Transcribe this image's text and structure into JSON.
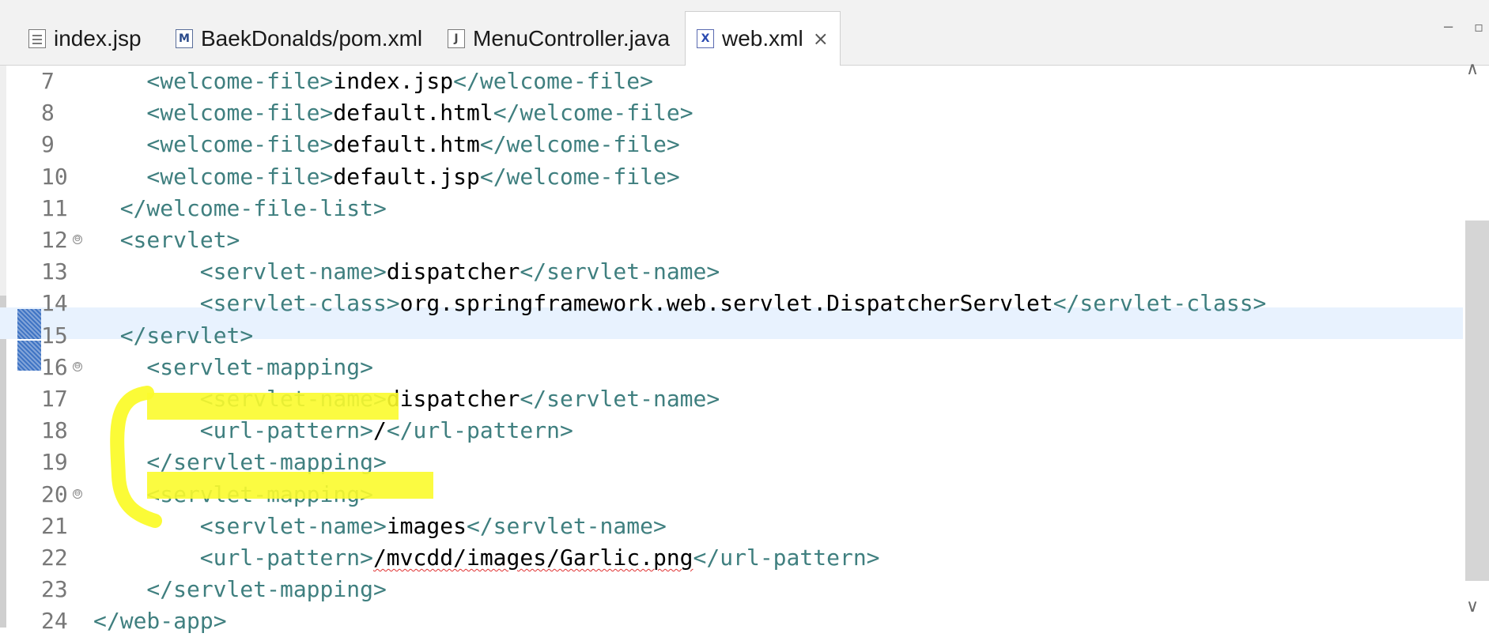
{
  "tabs": [
    {
      "label": "index.jsp",
      "icon": "jsp-file-icon",
      "active": false
    },
    {
      "label": "BaekDonalds/pom.xml",
      "icon": "maven-pom-icon",
      "active": false
    },
    {
      "label": "MenuController.java",
      "icon": "java-file-icon",
      "active": false
    },
    {
      "label": "web.xml",
      "icon": "xml-file-icon",
      "active": true
    }
  ],
  "tab_close_glyph": "×",
  "window_controls": {
    "minimize": "−",
    "maximize": "▫"
  },
  "scrollbar": {
    "up": "∧",
    "down": "∨"
  },
  "fold_glyph": "⊖",
  "highlight_color": "#fbfb2c",
  "current_line": "15",
  "editor": {
    "lines": [
      {
        "n": "7",
        "pre": "    ",
        "open": "<welcome-file>",
        "text": "index.jsp",
        "close": "</welcome-file>"
      },
      {
        "n": "8",
        "pre": "    ",
        "open": "<welcome-file>",
        "text": "default.html",
        "close": "</welcome-file>"
      },
      {
        "n": "9",
        "pre": "    ",
        "open": "<welcome-file>",
        "text": "default.htm",
        "close": "</welcome-file>"
      },
      {
        "n": "10",
        "pre": "    ",
        "open": "<welcome-file>",
        "text": "default.jsp",
        "close": "</welcome-file>"
      },
      {
        "n": "11",
        "pre": "  ",
        "open": "</welcome-file-list>"
      },
      {
        "n": "12",
        "pre": "  ",
        "open": "<servlet>"
      },
      {
        "n": "13",
        "pre": "        ",
        "open": "<servlet-name>",
        "text": "dispatcher",
        "close": "</servlet-name>"
      },
      {
        "n": "14",
        "pre": "        ",
        "open": "<servlet-class>",
        "text": "org.springframework.web.servlet.DispatcherServlet",
        "close": "</servlet-class>"
      },
      {
        "n": "15",
        "pre": "  ",
        "open": "</servlet>"
      },
      {
        "n": "16",
        "pre": "    ",
        "open": "<servlet-mapping>"
      },
      {
        "n": "17",
        "pre": "        ",
        "open": "<servlet-name>",
        "text": "dispatcher",
        "close": "</servlet-name>"
      },
      {
        "n": "18",
        "pre": "        ",
        "open": "<url-pattern>",
        "text": "/",
        "close": "</url-pattern>"
      },
      {
        "n": "19",
        "pre": "    ",
        "open": "</servlet-mapping>"
      },
      {
        "n": "20",
        "pre": "    ",
        "open": "<servlet-mapping>"
      },
      {
        "n": "21",
        "pre": "        ",
        "open": "<servlet-name>",
        "text": "images",
        "close": "</servlet-name>"
      },
      {
        "n": "22",
        "pre": "        ",
        "open": "<url-pattern>",
        "text": "/mvcdd/images/Garlic.png",
        "close": "</url-pattern>"
      },
      {
        "n": "23",
        "pre": "    ",
        "open": "</servlet-mapping>"
      },
      {
        "n": "24",
        "pre": "",
        "open": "</web-app>"
      }
    ]
  }
}
